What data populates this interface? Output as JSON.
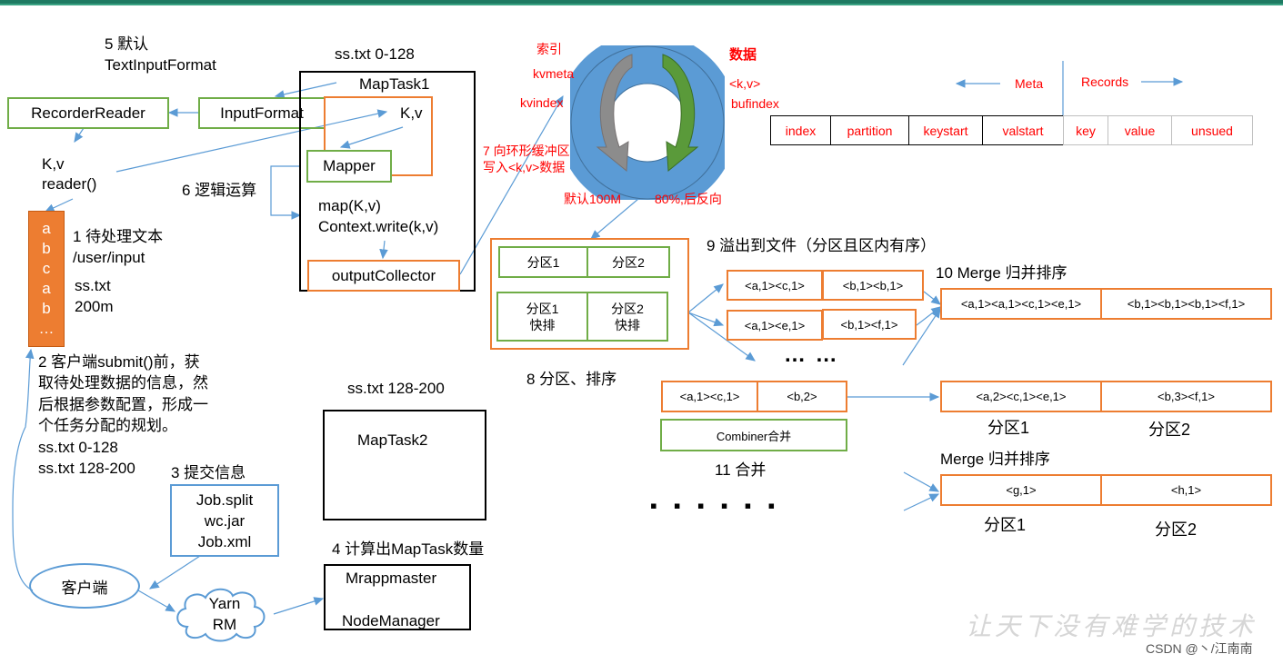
{
  "labels": {
    "step5_line1": "5 默认",
    "step5_line2": "TextInputFormat",
    "maptask1_range": "ss.txt 0-128",
    "maptask1": "MapTask1",
    "recorder_reader": "RecorderReader",
    "input_format": "InputFormat",
    "kv_inner": "K,v",
    "kv_left": "K,v",
    "reader_call": "reader()",
    "mapper": "Mapper",
    "step6": "6 逻辑运算",
    "map_call": "map(K,v)",
    "context_write": "Context.write(k,v)",
    "output_collector": "outputCollector",
    "step1_line1": "1 待处理文本",
    "step1_line2": "/user/input",
    "file_name": "ss.txt",
    "file_size": "200m",
    "file_chars": [
      "a",
      "b",
      "c",
      "a",
      "b",
      "…"
    ],
    "step2": [
      "2 客户端submit()前，获",
      "取待处理数据的信息，然",
      "后根据参数配置，形成一",
      "个任务分配的规划。"
    ],
    "split1": "ss.txt  0-128",
    "split2": "ss.txt  128-200",
    "step3": "3 提交信息",
    "job_files": [
      "Job.split",
      "wc.jar",
      "Job.xml"
    ],
    "client": "客户端",
    "yarn_line1": "Yarn",
    "yarn_line2": "RM",
    "maptask2_range": "ss.txt 128-200",
    "maptask2": "MapTask2",
    "step4": "4 计算出MapTask数量",
    "mrappmaster": "Mrappmaster",
    "nodemanager": "NodeManager",
    "ring_index": "索引",
    "ring_kvmeta": "kvmeta",
    "ring_kvindex": "kvindex",
    "ring_data": "数据",
    "ring_kv": "<k,v>",
    "ring_bufindex": "bufindex",
    "step7_line1": "7 向环形缓冲区",
    "step7_line2": "写入<k,v>数据",
    "ring_default": "默认100M",
    "ring_threshold": "80%,后反向",
    "meta_label": "Meta",
    "records_label": "Records",
    "buffer_cells": [
      "index",
      "partition",
      "keystart",
      "valstart",
      "key",
      "value",
      "unsued"
    ],
    "partition1": "分区1",
    "partition2": "分区2",
    "partition1_sort": [
      "分区1",
      "快排"
    ],
    "partition2_sort": [
      "分区2",
      "快排"
    ],
    "step8": "8 分区、排序",
    "step9": "9 溢出到文件（分区且区内有序）",
    "spill1": [
      "<a,1><c,1>",
      "<b,1><b,1>"
    ],
    "spill2": [
      "<a,1><e,1>",
      "<b,1><f,1>"
    ],
    "ellipsis_mid": "… …",
    "step10": "10 Merge 归并排序",
    "merged": [
      "<a,1><a,1><c,1><e,1>",
      "<b,1><b,1><b,1><f,1>"
    ],
    "combine_in": [
      "<a,1><c,1>",
      "<b,2>"
    ],
    "combiner": "Combiner合并",
    "step11": "11 合并",
    "combined": [
      "<a,2><c,1><e,1>",
      "<b,3><f,1>"
    ],
    "combined_p1": "分区1",
    "combined_p2": "分区2",
    "merge2": "Merge 归并排序",
    "final": [
      "<g,1>",
      "<h,1>"
    ],
    "final_p1": "分区1",
    "final_p2": "分区2",
    "ellipsis_bottom": "▪ ▪ ▪   ▪ ▪ ▪",
    "watermark": "让天下没有难学的技术",
    "credit": "CSDN @丶/江南南"
  },
  "colors": {
    "header": "#1e7a62",
    "green_box": "#70ad47",
    "orange_box": "#ed7d31",
    "arrow_blue": "#5b9bd5",
    "ring_blue": "#5b9bd5",
    "text_red": "#ff0000"
  }
}
